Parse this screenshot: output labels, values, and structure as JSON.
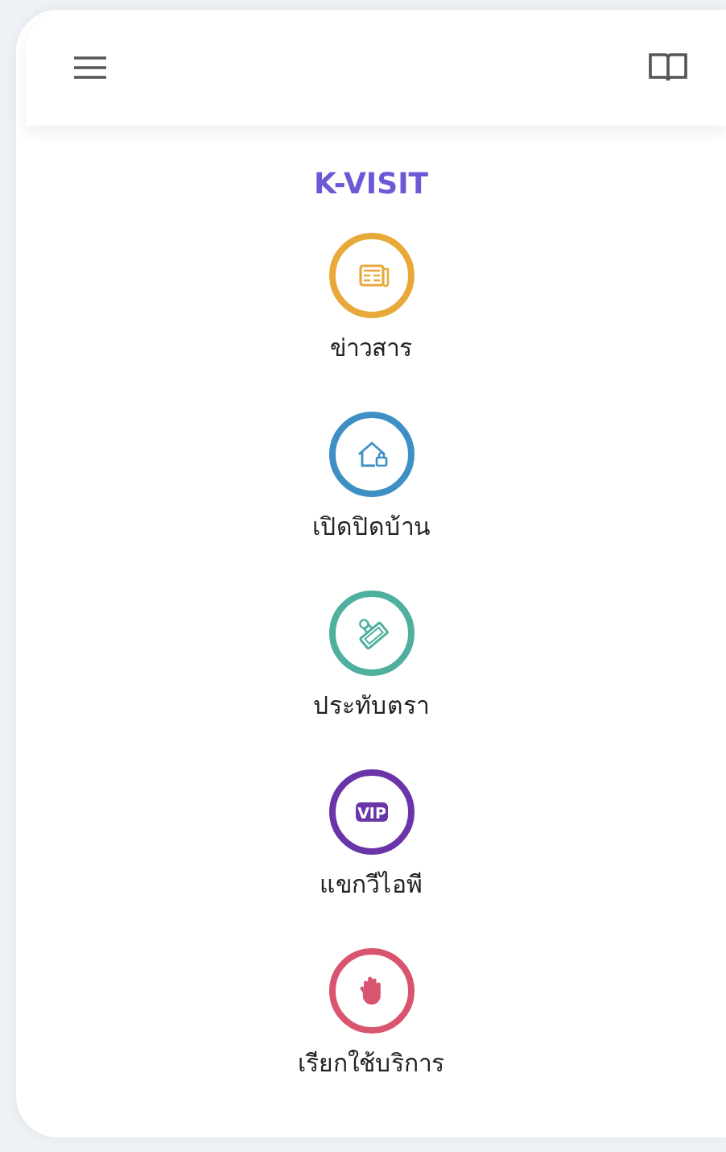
{
  "app_title": "K-VISIT",
  "menu_items": [
    {
      "kind": "news",
      "label": "ข่าวสาร",
      "color": "#e8a93a"
    },
    {
      "kind": "house",
      "label": "เปิดปิดบ้าน",
      "color": "#3d8fc4"
    },
    {
      "kind": "stamp",
      "label": "ประทับตรา",
      "color": "#4fb0a0"
    },
    {
      "kind": "vip",
      "label": "แขกวีไอพี",
      "color": "#6a35a8",
      "badge": "VIP"
    },
    {
      "kind": "hand",
      "label": "เรียกใช้บริการ",
      "color": "#d9546e"
    }
  ]
}
